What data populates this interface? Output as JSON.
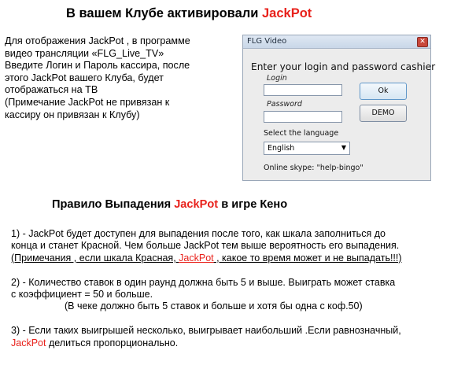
{
  "header": {
    "title_prefix": "В вашем Клубе активировали ",
    "title_highlight": "JackPot"
  },
  "intro": {
    "lines": [
      "Для отображения JackPot , в программе",
      "видео трансляции «FLG_Live_TV»",
      " Введите Логин и Пароль кассира, после",
      " этого  JackPot вашего Клуба, будет",
      " отображаться на ТВ",
      "(Примечание JackPot не привязан к",
      "кассиру он привязан к Клубу)"
    ]
  },
  "dialog": {
    "window_title": "FLG Video",
    "close_glyph": "✕",
    "heading": "Enter your login and password cashier",
    "login_label": "Login",
    "password_label": "Password",
    "ok_label": "Ok",
    "demo_label": "DEMO",
    "language_label": "Select the language",
    "language_value": "English",
    "dropdown_glyph": "▼",
    "skype_text": "Online skype: \"help-bingo\""
  },
  "section2": {
    "title_prefix": "Правило Выпадения ",
    "title_highlight": "JackPot",
    "title_suffix": " в игре Кено"
  },
  "rules": {
    "r1_line1": "1) - JackPot будет доступен для выпадения после того, как шкала заполниться до",
    "r1_line2": "конца и станет Красной. Чем больше JackPot тем выше вероятность его выпадения.",
    "r1_line3_a": "(Примечания , если шкала Красная, ",
    "r1_line3_highlight": "JackPot",
    "r1_line3_b": " , какое то время может и не выпадать!!!)",
    "r2_line1": "2) - Количество ставок в один раунд должна быть 5 и выше. Выиграть может ставка",
    "r2_line2": " с  коэффициент = 50 и больше.",
    "r2_line3": "(В чеке должно быть 5 ставок и больше и хотя бы одна с коф.50)",
    "r3_line1": "3) - Если таких выигрышей несколько, выигрывает наибольший .Если равнозначный,",
    "r3_line2_highlight": "JackPot",
    "r3_line2_b": " делиться пропорционально."
  },
  "colors": {
    "highlight": "#e8211b"
  }
}
